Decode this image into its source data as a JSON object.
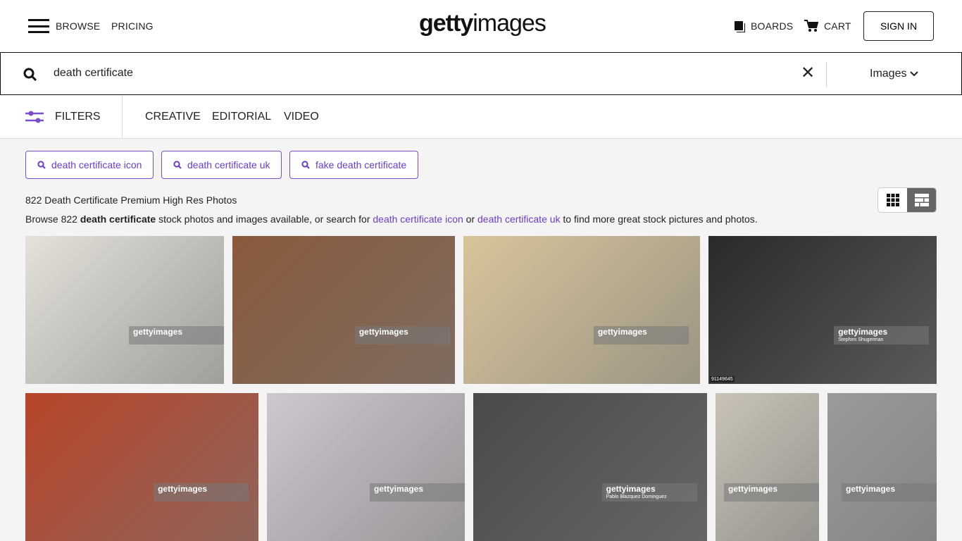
{
  "header": {
    "browse": "BROWSE",
    "pricing": "PRICING",
    "logo_bold": "getty",
    "logo_light": "images",
    "boards": "BOARDS",
    "cart": "CART",
    "sign_in": "SIGN IN"
  },
  "search": {
    "query": "death certificate",
    "type": "Images"
  },
  "filters": {
    "label": "FILTERS",
    "tabs": [
      "CREATIVE",
      "EDITORIAL",
      "VIDEO"
    ]
  },
  "suggestions": [
    "death certificate icon",
    "death certificate uk",
    "fake death certificate"
  ],
  "results": {
    "title": "822 Death Certificate Premium High Res Photos",
    "browse_pre": "Browse 822 ",
    "browse_bold": "death certificate",
    "browse_mid": " stock photos and images available, or search for ",
    "link1": "death certificate icon",
    "or": " or ",
    "link2": "death certificate uk",
    "browse_post": " to find more great stock pictures and photos."
  },
  "accent": "#6a3fc0",
  "images": [
    {
      "watermark": "gettyimages",
      "credit": "",
      "id": "",
      "color": "#e4e1da"
    },
    {
      "watermark": "gettyimages",
      "credit": "",
      "id": "",
      "color": "#8a5a3c"
    },
    {
      "watermark": "gettyimages",
      "credit": "",
      "id": "",
      "color": "#d8c49a"
    },
    {
      "watermark": "gettyimages",
      "credit": "Stephen Shugerman",
      "id": "91149645",
      "color": "#2a2a2a"
    },
    {
      "watermark": "gettyimages",
      "credit": "",
      "id": "",
      "color": "#b8452a"
    },
    {
      "watermark": "gettyimages",
      "credit": "",
      "id": "",
      "color": "#cfc7cf"
    },
    {
      "watermark": "gettyimages",
      "credit": "Pablo Blazquez Dominguez",
      "id": "",
      "color": "#4a4a4a"
    },
    {
      "watermark": "gettyimages",
      "credit": "",
      "id": "",
      "color": "#c9c3b6"
    },
    {
      "watermark": "gettyimages",
      "credit": "",
      "id": "",
      "color": "#9a9a9a"
    }
  ]
}
